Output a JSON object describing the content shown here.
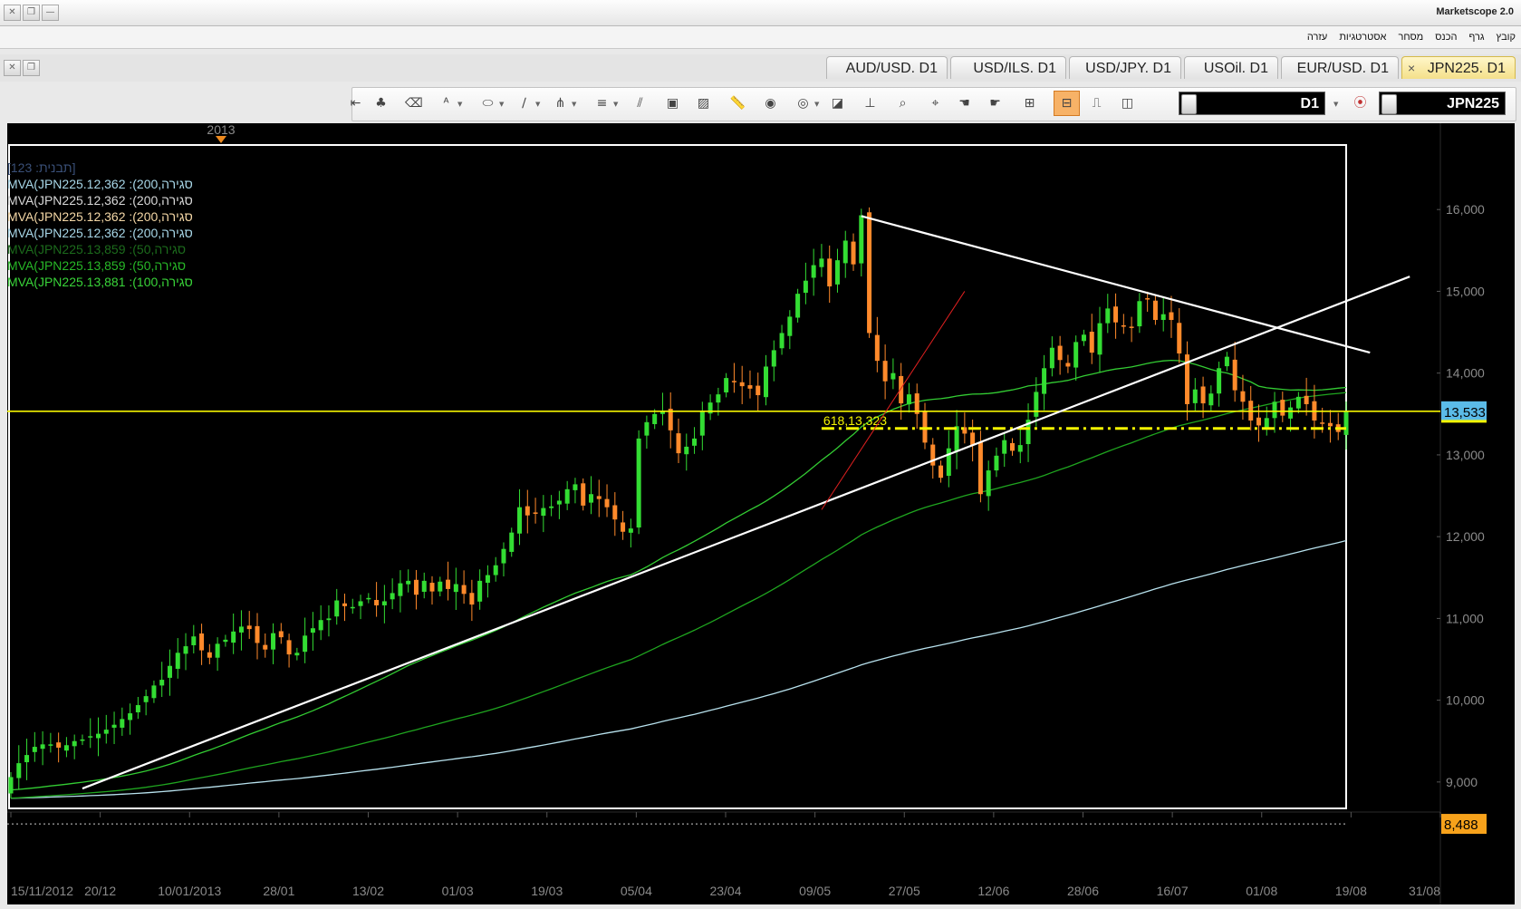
{
  "window": {
    "title": "Marketscope 2.0"
  },
  "menu": [
    "קובץ",
    "גרף",
    "הכנס",
    "מסחר",
    "אסטרטגיות",
    "עזרה"
  ],
  "tabs": [
    {
      "label": "AUD/USD. D1"
    },
    {
      "label": "USD/ILS. D1"
    },
    {
      "label": "USD/JPY. D1"
    },
    {
      "label": "USOil. D1"
    },
    {
      "label": "EUR/USD. D1"
    },
    {
      "label": "JPN225. D1",
      "active": true
    }
  ],
  "toolbar": {
    "timeframe": "D1",
    "instrument": "JPN225",
    "icons": [
      "pin-icon",
      "tree-icon",
      "eraser-icon",
      "text-abc-icon",
      "ellipse-icon",
      "pen-line-icon",
      "fork-icon",
      "list-lines-icon",
      "parallel-lines-icon",
      "window-icon",
      "picture-icon",
      "ruler-icon",
      "globe-icon",
      "eye-icon",
      "chart-edit-icon",
      "level-icon",
      "zoom-icon",
      "cursor-icon",
      "hand-icon",
      "hand2-icon",
      "ticks-icon",
      "candles-icon",
      "line-chart-icon",
      "binoculars-icon"
    ]
  },
  "legend": {
    "header": "[תבנית: 123]",
    "lines": [
      {
        "text": "MVA(JPN225.12,362 :(200,סגירה",
        "color": "#a8d7e8"
      },
      {
        "text": "MVA(JPN225.12,362 :(200,סגירה",
        "color": "#d8d8d8"
      },
      {
        "text": "MVA(JPN225.12,362 :(200,סגירה",
        "color": "#f4d7a6"
      },
      {
        "text": "MVA(JPN225.12,362 :(200,סגירה",
        "color": "#a8d7e8"
      },
      {
        "text": "MVA(JPN225.13,859 :(50,סגירה",
        "color": "#1c6b1c"
      },
      {
        "text": "MVA(JPN225.13,859 :(50,סגירה",
        "color": "#27b827"
      },
      {
        "text": "MVA(JPN225.13,881 :(100,סגירה",
        "color": "#39d439"
      }
    ]
  },
  "chart_data": {
    "type": "candlestick",
    "symbol": "JPN225",
    "timeframe": "D1",
    "year_marker": "2013",
    "xlabels": [
      "15/11/2012",
      "20/12",
      "10/01/2013",
      "28/01",
      "13/02",
      "01/03",
      "19/03",
      "05/04",
      "23/04",
      "09/05",
      "27/05",
      "12/06",
      "28/06",
      "16/07",
      "01/08",
      "19/08",
      "31/08"
    ],
    "yticks": [
      "16,000",
      "15,000",
      "14,000",
      "13,000",
      "12,000",
      "11,000",
      "10,000",
      "9,000"
    ],
    "ylim": [
      8450,
      16500
    ],
    "current_price_label": "13,533",
    "low_price_label": "8,488",
    "horizontal_level": 13533,
    "fib_label": "618,13,323",
    "fib_level": 13323,
    "low_level": 8488,
    "close_series": [
      9060,
      9230,
      9330,
      9430,
      9460,
      9460,
      9420,
      9450,
      9500,
      9520,
      9560,
      9590,
      9640,
      9700,
      9770,
      9840,
      9940,
      10050,
      10180,
      10250,
      10420,
      10580,
      10660,
      10780,
      10610,
      10520,
      10690,
      10740,
      10840,
      10900,
      10870,
      10700,
      10620,
      10820,
      10770,
      10560,
      10580,
      10790,
      10880,
      10980,
      11000,
      11220,
      11150,
      11140,
      11210,
      11250,
      11160,
      11210,
      11310,
      11430,
      11460,
      11290,
      11460,
      11330,
      11450,
      11360,
      11420,
      11300,
      11170,
      11460,
      11530,
      11650,
      11850,
      12050,
      12360,
      12260,
      12280,
      12350,
      12370,
      12440,
      12580,
      12640,
      12380,
      12520,
      12460,
      12360,
      12210,
      12060,
      12100,
      13200,
      13400,
      13500,
      13540,
      13300,
      13020,
      13100,
      13200,
      13530,
      13640,
      13740,
      13940,
      13900,
      13840,
      13810,
      13730,
      14080,
      14280,
      14490,
      14690,
      14970,
      15130,
      15320,
      15400,
      15060,
      15380,
      15620,
      15330,
      15930,
      14490,
      14150,
      13900,
      14000,
      13630,
      13740,
      13500,
      13150,
      12870,
      12720,
      13080,
      13350,
      13260,
      13120,
      12520,
      12810,
      12990,
      13180,
      13050,
      13120,
      13430,
      13770,
      14060,
      14310,
      14160,
      14080,
      14380,
      14470,
      14250,
      14610,
      14790,
      14620,
      14580,
      14560,
      14880,
      14910,
      14650,
      14720,
      14650,
      14240,
      13620,
      13800,
      13630,
      13750,
      14060,
      14200,
      13790,
      13650,
      13420,
      13360,
      13450,
      13650,
      13480,
      13580,
      13710,
      13620,
      13420,
      13390,
      13350,
      13280,
      13533
    ],
    "series": [
      {
        "name": "MVA 50",
        "color": "#33cc33"
      },
      {
        "name": "MVA 100",
        "color": "#1fa51f"
      },
      {
        "name": "MVA 200",
        "color": "#b8e2ee"
      }
    ],
    "trendlines": [
      {
        "from": [
          9,
          8920
        ],
        "to": [
          176,
          15180
        ],
        "color": "#ffffff"
      },
      {
        "from": [
          107,
          15920
        ],
        "to": [
          171,
          14250
        ],
        "color": "#ffffff"
      },
      {
        "from": [
          102,
          12330
        ],
        "to": [
          120,
          15000
        ],
        "color": "#e02020"
      }
    ]
  }
}
